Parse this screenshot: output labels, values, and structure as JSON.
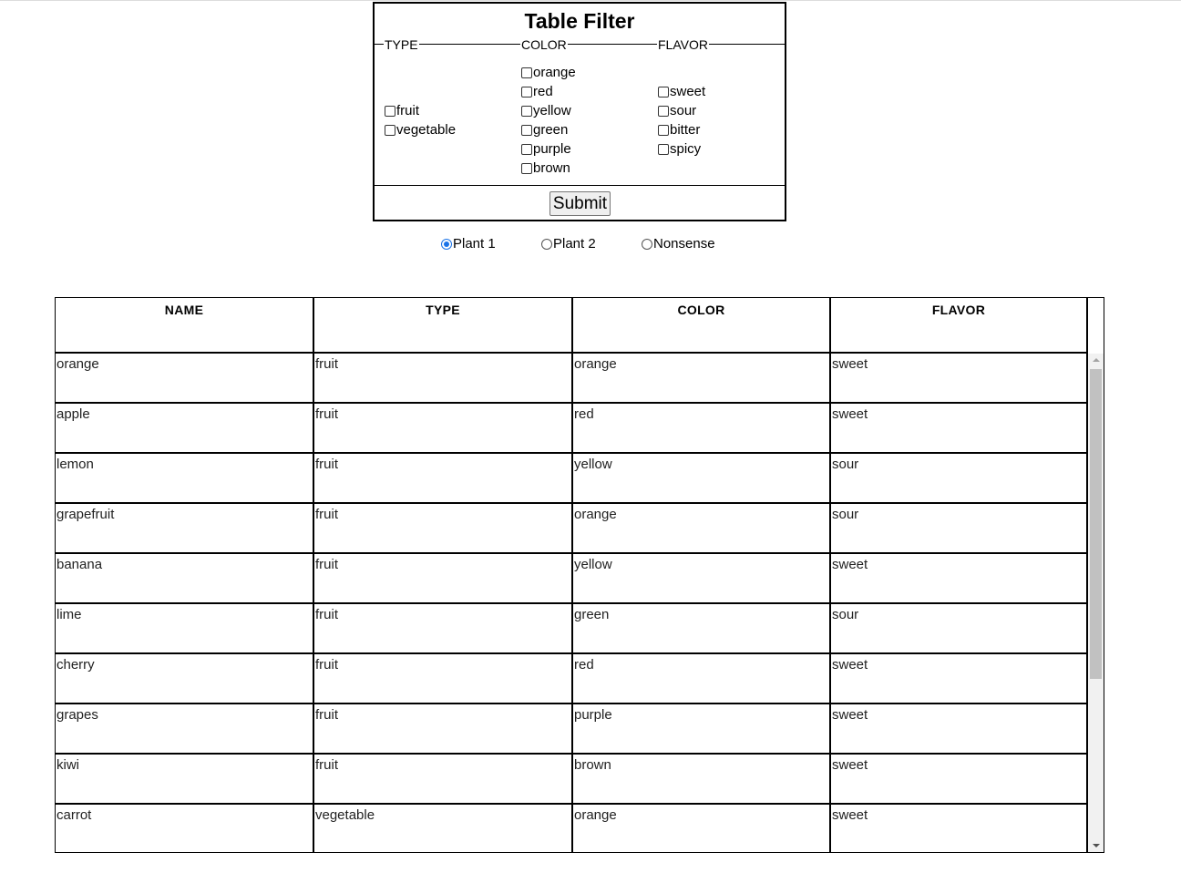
{
  "filter": {
    "title": "Table Filter",
    "sections": {
      "type": {
        "label": "TYPE",
        "options": [
          "fruit",
          "vegetable"
        ]
      },
      "color": {
        "label": "COLOR",
        "options": [
          "orange",
          "red",
          "yellow",
          "green",
          "purple",
          "brown"
        ]
      },
      "flavor": {
        "label": "FLAVOR",
        "options": [
          "sweet",
          "sour",
          "bitter",
          "spicy"
        ]
      }
    },
    "submit_label": "Submit"
  },
  "dataset": {
    "options": [
      "Plant 1",
      "Plant 2",
      "Nonsense"
    ],
    "selected": "Plant 1"
  },
  "table": {
    "headers": [
      "NAME",
      "TYPE",
      "COLOR",
      "FLAVOR"
    ],
    "rows": [
      [
        "orange",
        "fruit",
        "orange",
        "sweet"
      ],
      [
        "apple",
        "fruit",
        "red",
        "sweet"
      ],
      [
        "lemon",
        "fruit",
        "yellow",
        "sour"
      ],
      [
        "grapefruit",
        "fruit",
        "orange",
        "sour"
      ],
      [
        "banana",
        "fruit",
        "yellow",
        "sweet"
      ],
      [
        "lime",
        "fruit",
        "green",
        "sour"
      ],
      [
        "cherry",
        "fruit",
        "red",
        "sweet"
      ],
      [
        "grapes",
        "fruit",
        "purple",
        "sweet"
      ],
      [
        "kiwi",
        "fruit",
        "brown",
        "sweet"
      ],
      [
        "carrot",
        "vegetable",
        "orange",
        "sweet"
      ]
    ]
  }
}
